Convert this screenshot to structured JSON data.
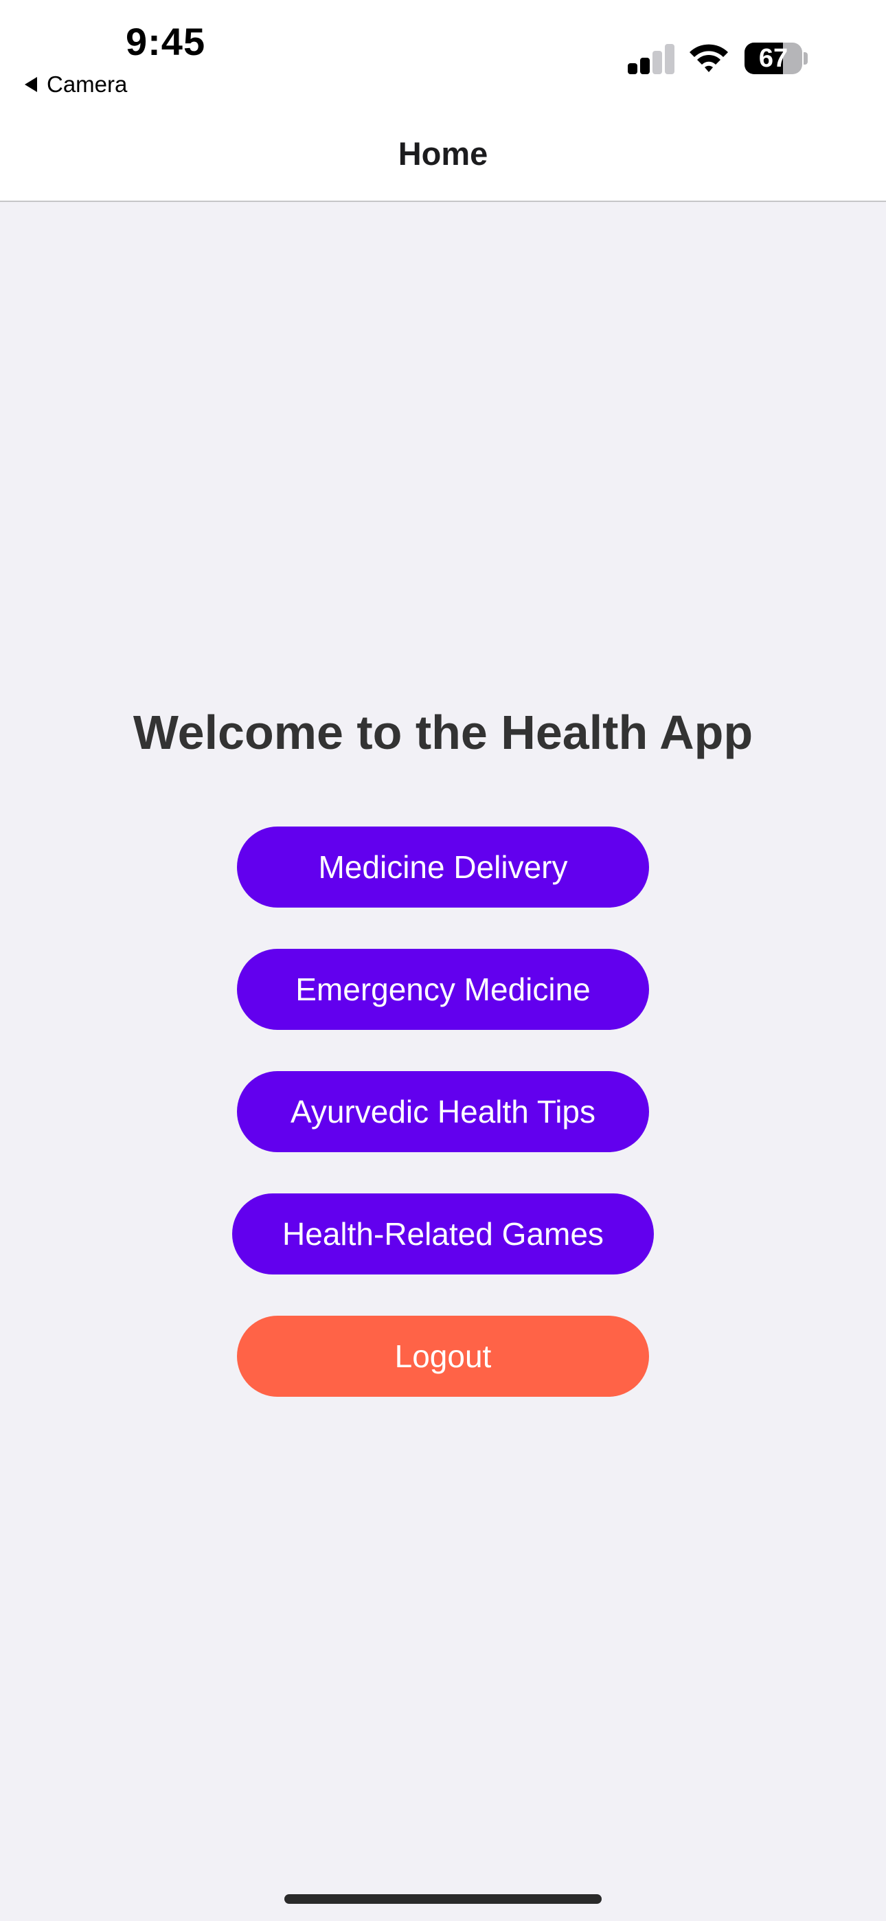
{
  "status_bar": {
    "time": "9:45",
    "back_app": "Camera",
    "battery_percent": "67",
    "battery_level": 0.67,
    "signal_bars_active": 2,
    "signal_bars_total": 4
  },
  "nav": {
    "title": "Home"
  },
  "main": {
    "welcome": "Welcome to the Health App",
    "buttons": [
      {
        "label": "Medicine Delivery",
        "color": "#6200ee"
      },
      {
        "label": "Emergency Medicine",
        "color": "#6200ee"
      },
      {
        "label": "Ayurvedic Health Tips",
        "color": "#6200ee"
      },
      {
        "label": "Health-Related Games",
        "color": "#6200ee"
      }
    ],
    "logout": {
      "label": "Logout",
      "color": "#ff6347"
    }
  },
  "colors": {
    "background": "#f2f1f6",
    "header": "#ffffff",
    "primary": "#6200ee",
    "danger": "#ff6347",
    "heading_text": "#333333"
  },
  "icons": {
    "back": "back-triangle-icon",
    "signal": "cellular-signal-icon",
    "wifi": "wifi-icon",
    "battery": "battery-icon"
  }
}
